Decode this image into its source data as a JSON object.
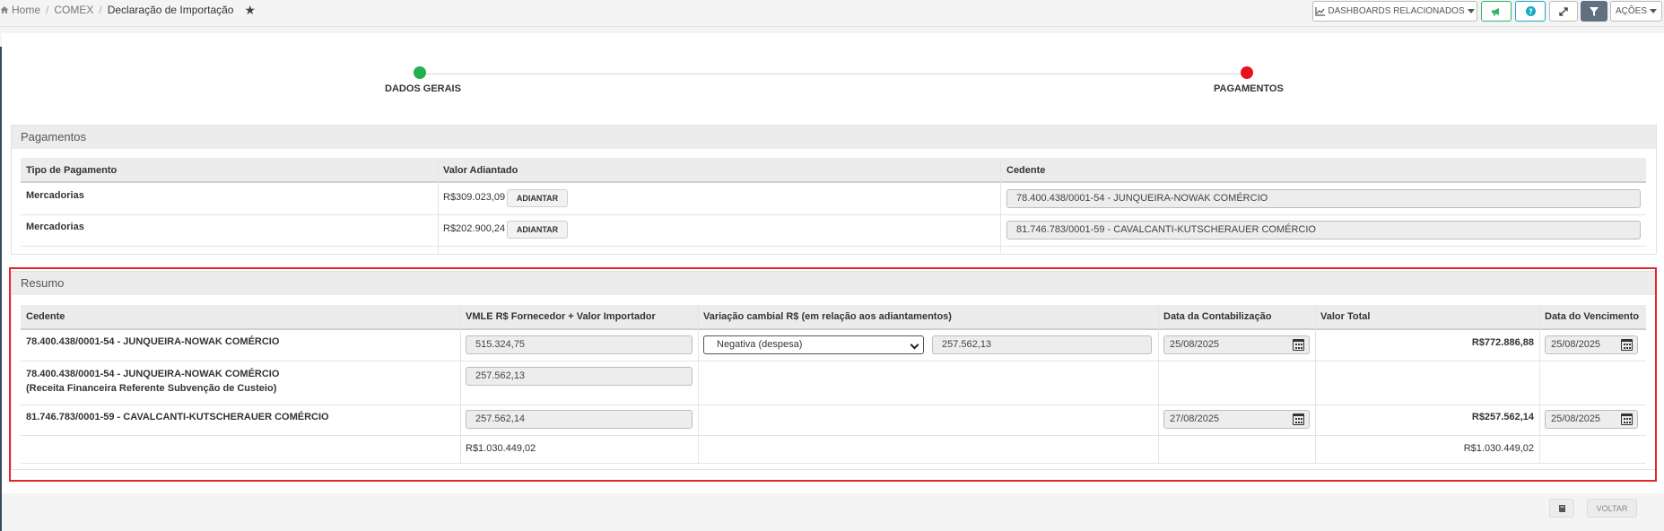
{
  "breadcrumb": {
    "home": "Home",
    "module": "COMEX",
    "current": "Declaração de Importação"
  },
  "toolbar": {
    "dashboards_label": "DASHBOARDS RELACIONADOS",
    "acoes_label": "AÇÕES"
  },
  "stepper": {
    "step1": {
      "label": "DADOS GERAIS",
      "color": "#22b14c"
    },
    "step2": {
      "label": "PAGAMENTOS",
      "color": "#e8141c"
    }
  },
  "pagamentos": {
    "title": "Pagamentos",
    "headers": {
      "tipo": "Tipo de Pagamento",
      "valor": "Valor Adiantado",
      "cedente": "Cedente"
    },
    "rows": [
      {
        "tipo": "Mercadorias",
        "valor": "R$309.023,09",
        "button": "ADIANTAR",
        "cedente": "78.400.438/0001-54 - JUNQUEIRA-NOWAK COMÉRCIO"
      },
      {
        "tipo": "Mercadorias",
        "valor": "R$202.900,24",
        "button": "ADIANTAR",
        "cedente": "81.746.783/0001-59 - CAVALCANTI-KUTSCHERAUER COMÉRCIO"
      }
    ]
  },
  "resumo": {
    "title": "Resumo",
    "headers": {
      "cedente": "Cedente",
      "vmle": "VMLE R$ Fornecedor + Valor Importador",
      "variacao": "Variação cambial R$ (em relação aos adiantamentos)",
      "data_contab": "Data da Contabilização",
      "valor_total": "Valor Total",
      "data_venc": "Data do Vencimento"
    },
    "rows": [
      {
        "cedente": "78.400.438/0001-54 - JUNQUEIRA-NOWAK COMÉRCIO",
        "vmle": "515.324,75",
        "variacao_tipo": "Negativa (despesa)",
        "variacao_valor": "257.562,13",
        "data_contab": "25/08/2025",
        "valor_total": "R$772.886,88",
        "data_venc": "25/08/2025"
      },
      {
        "cedente": "78.400.438/0001-54 - JUNQUEIRA-NOWAK COMÉRCIO",
        "cedente_sub": "(Receita Financeira Referente Subvenção de Custeio)",
        "vmle": "257.562,13"
      },
      {
        "cedente": "81.746.783/0001-59 - CAVALCANTI-KUTSCHERAUER COMÉRCIO",
        "vmle": "257.562,14",
        "data_contab": "27/08/2025",
        "valor_total": "R$257.562,14",
        "data_venc": "25/08/2025"
      }
    ],
    "totals": {
      "vmle": "R$1.030.449,02",
      "valor_total": "R$1.030.449,02"
    }
  },
  "footer": {
    "voltar_label": "VOLTAR"
  },
  "colors": {
    "highlight": "#e3262b",
    "green": "#2fb36a",
    "teal": "#1aa8c7"
  }
}
